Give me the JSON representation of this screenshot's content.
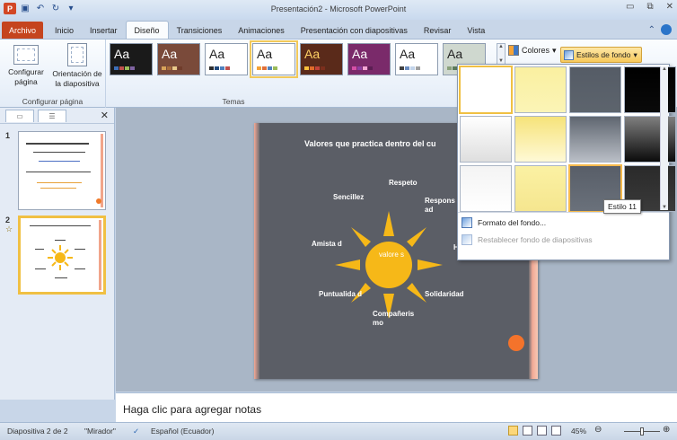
{
  "window": {
    "title": "Presentación2 - Microsoft PowerPoint",
    "qat": [
      "ppt-logo-icon",
      "save-icon",
      "undo-icon",
      "redo-icon",
      "customize-icon"
    ]
  },
  "tabs": [
    "Archivo",
    "Inicio",
    "Insertar",
    "Diseño",
    "Transiciones",
    "Animaciones",
    "Presentación con diapositivas",
    "Revisar",
    "Vista"
  ],
  "active_tab": "Diseño",
  "ribbon": {
    "configurar_pagina": "Configurar página",
    "orientacion": "Orientación de la diapositiva",
    "grupo_configurar": "Configurar página",
    "grupo_temas": "Temas",
    "colores": "Colores",
    "estilos_fondo": "Estilos de fondo",
    "themes": [
      {
        "bg": "#1a1a1a",
        "fg": "#ffffff",
        "bars": [
          "#3e6fb8",
          "#c0504d",
          "#9bbb59",
          "#8064a2"
        ]
      },
      {
        "bg": "#7a4a3a",
        "fg": "#ffffff",
        "bars": [
          "#d9a35a",
          "#a86c3c",
          "#e9c98a",
          "#6f3c2b"
        ]
      },
      {
        "bg": "#ffffff",
        "fg": "#222222",
        "bars": [
          "#2d2d2d",
          "#1f497d",
          "#4f81bd",
          "#c0504d"
        ]
      },
      {
        "bg": "#ffffff",
        "fg": "#222222",
        "bars": [
          "#f4a237",
          "#e0703a",
          "#4f81bd",
          "#9bbb59"
        ]
      },
      {
        "bg": "#5a2a1a",
        "fg": "#ffd166",
        "bars": [
          "#f8c03b",
          "#e06b2a",
          "#c2433a",
          "#7c2f1d"
        ]
      },
      {
        "bg": "#7a2a6a",
        "fg": "#ffffff",
        "bars": [
          "#d64fa7",
          "#8e3ea2",
          "#f2a6d4",
          "#5b1e53"
        ]
      },
      {
        "bg": "#ffffff",
        "fg": "#222222",
        "bars": [
          "#404040",
          "#6a8cc0",
          "#c2d4ea",
          "#a0a0a0"
        ]
      },
      {
        "bg": "#cfd8cf",
        "fg": "#222222",
        "bars": [
          "#8aa17b",
          "#5c7a5b",
          "#c9d7b8",
          "#3f5a3f"
        ]
      }
    ]
  },
  "slides_panel": {
    "slides": [
      {
        "number": "1"
      },
      {
        "number": "2",
        "starred": "☆"
      }
    ]
  },
  "slide": {
    "title": "Valores que  practica dentro del cu",
    "center": "valore s",
    "words": {
      "respeto": "Respeto",
      "responsabilidad": "Respons ad",
      "sencillez": "Sencillez",
      "amistad": "Amista d",
      "h": "H",
      "puntualidad": "Puntualida d",
      "solidaridad": "Solidaridad",
      "companerismo": "Compañeris mo"
    }
  },
  "dropdown": {
    "swatches": [
      [
        "#ffffff",
        "#ffffff"
      ],
      [
        "#faf0a0",
        "#fbf4b6"
      ],
      [
        "#555c66",
        "#5d646d"
      ],
      [
        "#000000",
        "#0a0a0a"
      ],
      [
        "#ffffff",
        "#dedede"
      ],
      [
        "#f6e37a",
        "#fff9d6"
      ],
      [
        "#5f6670",
        "#b9bec6"
      ],
      [
        "#7f7f7f",
        "#0b0b0b"
      ],
      [
        "#f4f4f4",
        "#ffffff"
      ],
      [
        "#fbf1a3",
        "#f5e68f"
      ],
      [
        "#585e68",
        "#6a717b"
      ],
      [
        "#2a2a2a",
        "#3a3a3a"
      ]
    ],
    "selected_index": 0,
    "hover_index": 10,
    "formato": "Formato del fondo...",
    "restablecer": "Restablecer fondo de diapositivas",
    "tooltip": "Estilo 11"
  },
  "notes": {
    "placeholder": "Haga clic para agregar notas"
  },
  "status": {
    "slide": "Diapositiva 2 de 2",
    "theme": "\"Mirador\"",
    "language": "Español (Ecuador)",
    "zoom": "45%"
  }
}
